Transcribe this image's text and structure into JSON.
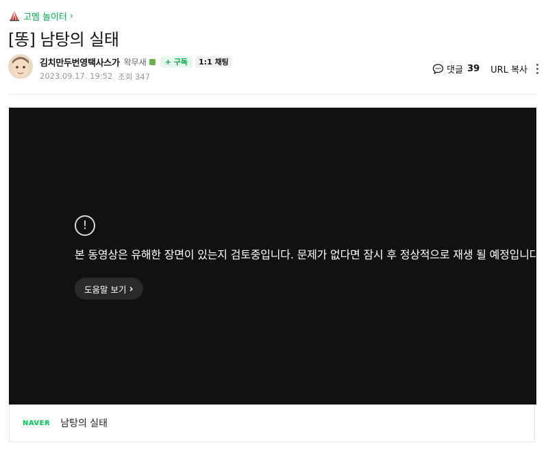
{
  "board": {
    "name": "고멤 놀이터",
    "chevron": "›",
    "icon": "tent-icon"
  },
  "post": {
    "title": "[똥] 남탕의 실태",
    "author": {
      "nickname": "김치만두번영택사스가",
      "rank": "왁무새",
      "level_badge_color": "#6ab04c",
      "subscribe_label": "+ 구독",
      "chat_label": "1:1 채팅"
    },
    "date": "2023.09.17. 19:52",
    "views_label": "조회 347"
  },
  "tools": {
    "comment_label": "댓글",
    "comment_count": "39",
    "url_copy_label": "URL 복사"
  },
  "video": {
    "warning_text": "본 동영상은 유해한 장면이 있는지 검토중입니다. 문제가 없다면 잠시 후 정상적으로 재생 될 예정입니다.",
    "help_label": "도움말 보기",
    "help_chevron": "›"
  },
  "caption": {
    "provider": "NAVER",
    "title": "남탕의 실태"
  },
  "colors": {
    "accent_green": "#03a94f",
    "video_bg": "#111111"
  }
}
